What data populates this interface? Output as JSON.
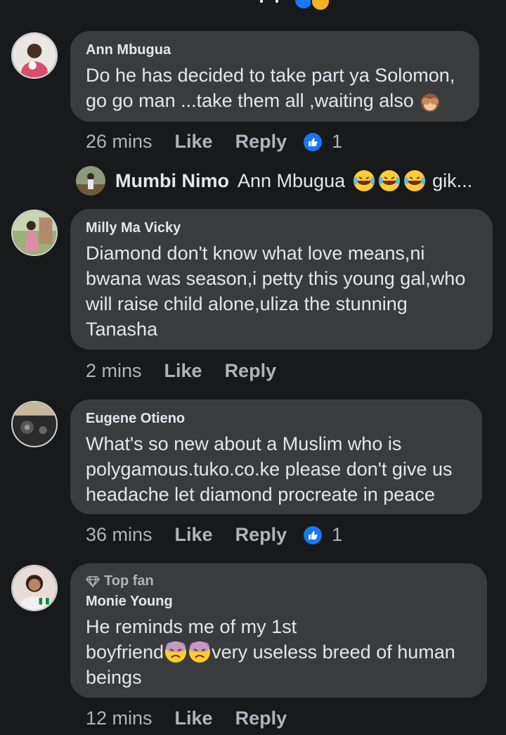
{
  "comments": [
    {
      "author": "Ann Mbugua",
      "text_line1": "Do he has decided to take part ya Solomon,",
      "text_line2": "go go man ...take them all ,waiting also",
      "time": "26 mins",
      "like_label": "Like",
      "reply_label": "Reply",
      "reaction_count": "1"
    },
    {
      "author": "Milly Ma Vicky",
      "text": "Diamond don't know what love means,ni bwana was season,i petty this young gal,who will raise child alone,uliza the stunning Tanasha",
      "time": "2 mins",
      "like_label": "Like",
      "reply_label": "Reply"
    },
    {
      "author": "Eugene Otieno",
      "text": "What's so new about a Muslim who is polygamous.tuko.co.ke please don't give us headache let diamond procreate in peace",
      "time": "36 mins",
      "like_label": "Like",
      "reply_label": "Reply",
      "reaction_count": "1"
    },
    {
      "badge": "Top fan",
      "author": "Monie Young",
      "text_line1": "He reminds me of my 1st",
      "text_line2a": "boyfriend",
      "text_line2b": "very useless breed of human",
      "text_line3": "beings",
      "time": "12 mins",
      "like_label": "Like",
      "reply_label": "Reply"
    }
  ],
  "reply_preview": {
    "author": "Mumbi Nimo",
    "mention": "Ann Mbugua",
    "suffix": "gik..."
  },
  "colors": {
    "background": "#18191a",
    "bubble": "#3a3b3c",
    "text": "#e4e6eb",
    "secondary": "#b0b3b8",
    "like_blue": "#1877f2"
  },
  "icons": [
    "thumbs-up-icon",
    "see-no-evil-monkey-emoji",
    "laughing-tears-emoji",
    "weary-face-emoji",
    "diamond-icon"
  ]
}
